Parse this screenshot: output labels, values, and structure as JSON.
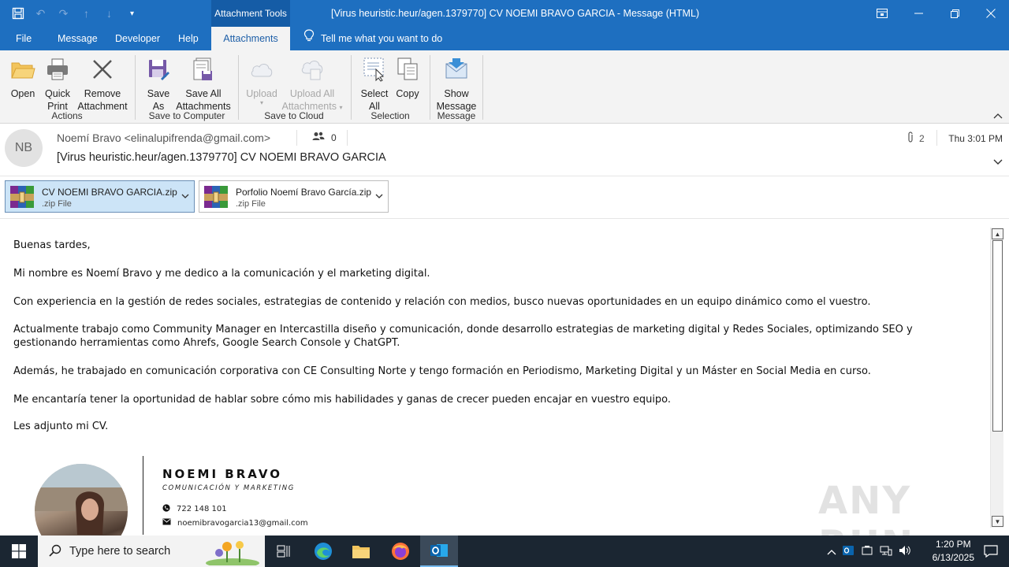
{
  "window": {
    "context_tab": "Attachment Tools",
    "title": "[Virus heuristic.heur/agen.1379770] CV NOEMI BRAVO GARCIA  -  Message (HTML)"
  },
  "tabs": [
    "File",
    "Message",
    "Developer",
    "Help",
    "Attachments"
  ],
  "active_tab": "Attachments",
  "tell_me": "Tell me what you want to do",
  "ribbon": {
    "open": "Open",
    "quick_print_1": "Quick",
    "quick_print_2": "Print",
    "remove_1": "Remove",
    "remove_2": "Attachment",
    "actions": "Actions",
    "save_as_1": "Save",
    "save_as_2": "As",
    "save_all_1": "Save All",
    "save_all_2": "Attachments",
    "save_to_computer": "Save to Computer",
    "upload": "Upload",
    "upload_all_1": "Upload All",
    "upload_all_2": "Attachments",
    "save_to_cloud": "Save to Cloud",
    "select_all_1": "Select",
    "select_all_2": "All",
    "copy": "Copy",
    "selection": "Selection",
    "show_message_1": "Show",
    "show_message_2": "Message",
    "message": "Message"
  },
  "header": {
    "initials": "NB",
    "from": "Noemí Bravo <elinalupifrenda@gmail.com>",
    "people_count": "0",
    "attachment_count": "2",
    "date": "Thu 3:01 PM",
    "subject": "[Virus heuristic.heur/agen.1379770] CV NOEMI BRAVO GARCIA"
  },
  "attachments": [
    {
      "name": "CV NOEMI BRAVO GARCIA.zip",
      "type": ".zip File"
    },
    {
      "name": "Porfolio Noemí Bravo García.zip",
      "type": ".zip File"
    }
  ],
  "body": {
    "p1": "Buenas tardes,",
    "p2": "Mi nombre es Noemí Bravo y me dedico a la comunicación y el marketing digital.",
    "p3": "Con experiencia en la gestión de redes sociales, estrategias de contenido y relación con medios, busco nuevas oportunidades en un equipo dinámico como el vuestro.",
    "p4": "Actualmente trabajo como Community Manager en Intercastilla diseño y comunicación, donde desarrollo estrategias de marketing digital y Redes Sociales, optimizando SEO y gestionando herramientas como Ahrefs, Google Search Console y ChatGPT.",
    "p5": "Además, he trabajado en comunicación corporativa con CE Consulting Norte y tengo formación en Periodismo, Marketing Digital y un Máster en Social Media en curso.",
    "p6": "Me encantaría tener la oportunidad de hablar sobre cómo mis habilidades y ganas de crecer pueden encajar en vuestro equipo.",
    "p7": "Les adjunto mi CV."
  },
  "signature": {
    "name": "NOEMI BRAVO",
    "role": "COMUNICACIÓN Y MARKETING",
    "phone": "722 148 101",
    "email": "noemibravogarcia13@gmail.com"
  },
  "watermark": "ANY RUN",
  "taskbar": {
    "search_placeholder": "Type here to search",
    "time": "1:20 PM",
    "date": "6/13/2025"
  }
}
